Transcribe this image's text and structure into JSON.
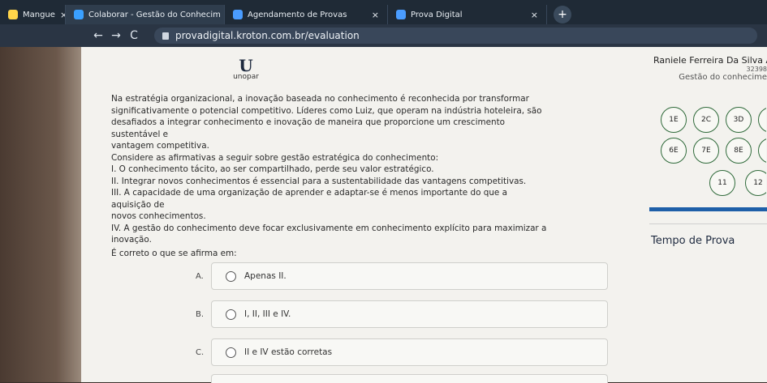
{
  "browser": {
    "tabs": [
      {
        "label": "Mangue",
        "color": "#ffd54a",
        "active": false
      },
      {
        "label": "Colaborar - Gestão do Conhecim",
        "color": "#3aa0ff",
        "active": true
      },
      {
        "label": "Agendamento de Provas",
        "color": "#4a9cff",
        "active": false
      },
      {
        "label": "Prova Digital",
        "color": "#4a9cff",
        "active": false
      }
    ],
    "tab_close": "×",
    "new_tab": "+",
    "nav_back": "←",
    "nav_forward": "→",
    "nav_reload": "C",
    "url": "provadigital.kroton.com.br/evaluation"
  },
  "header": {
    "logo_mark": "U",
    "logo_text": "unopar",
    "user_name": "Raniele Ferreira Da Silva Alme",
    "user_code": "32398",
    "course": "Gestão do conhecime"
  },
  "question": {
    "lines": [
      "Na estratégia organizacional, a inovação baseada no conhecimento é reconhecida por transformar",
      "significativamente o potencial competitivo. Líderes como Luiz, que operam na indústria hoteleira, são",
      "desafiados a integrar conhecimento e inovação de maneira que proporcione um crescimento sustentável e",
      "vantagem competitiva.",
      "Considere as afirmativas a seguir sobre gestão estratégica do conhecimento:",
      "I. O conhecimento tácito, ao ser compartilhado, perde seu valor estratégico.",
      "II. Integrar novos conhecimentos é essencial para a sustentabilidade das vantagens competitivas.",
      "III. A capacidade de uma organização de aprender e adaptar-se é menos importante do que a aquisição de",
      "novos conhecimentos.",
      "IV. A gestão do conhecimento deve focar exclusivamente em conhecimento explícito para maximizar a",
      "inovação."
    ],
    "prompt": "É correto o que se afirma em:"
  },
  "options": [
    {
      "letter": "A.",
      "text": "Apenas II."
    },
    {
      "letter": "B.",
      "text": "I, II, III e IV."
    },
    {
      "letter": "C.",
      "text": "II e IV estão corretas"
    }
  ],
  "navigator": {
    "buttons": [
      "1E",
      "2C",
      "3D",
      "6E",
      "7E",
      "8E",
      "11",
      "12"
    ]
  },
  "timer_label": "Tempo de Prova",
  "colors": {
    "accent": "#1e5fa8",
    "answered_ring": "#2f6a3a"
  }
}
